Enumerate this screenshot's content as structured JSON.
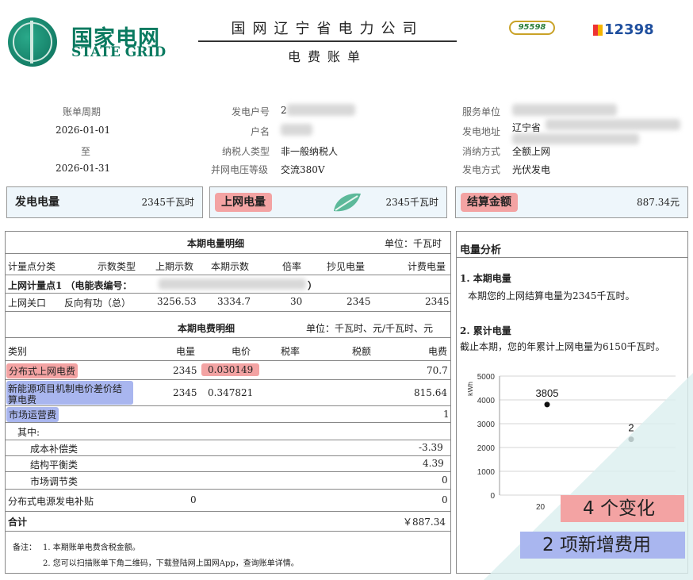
{
  "header": {
    "brand_cn": "国家电网",
    "brand_en": "STATE GRID",
    "company": "国网辽宁省电力公司",
    "bill_title": "电费账单",
    "hotline_95598": "95598",
    "hotline_12398": "12398"
  },
  "info": {
    "period_label": "账单周期",
    "period_start": "2026-01-01",
    "period_to": "至",
    "period_end": "2026-01-31",
    "account_label": "发电户号",
    "account_value": "2",
    "name_label": "户名",
    "taxpayer_label": "纳税人类型",
    "taxpayer_value": "非一般纳税人",
    "voltage_label": "并网电压等级",
    "voltage_value": "交流380V",
    "service_label": "服务单位",
    "address_label": "发电地址",
    "address_value": "辽宁省",
    "consumption_label": "消纳方式",
    "consumption_value": "全额上网",
    "gen_type_label": "发电方式",
    "gen_type_value": "光伏发电"
  },
  "summary": {
    "generation_label": "发电电量",
    "generation_value": "2345千瓦时",
    "grid_label": "上网电量",
    "grid_value": "2345千瓦时",
    "settle_label": "结算金额",
    "settle_value": "887.34元"
  },
  "energy_detail": {
    "title": "本期电量明细",
    "unit": "单位：千瓦时",
    "headers": [
      "计量点分类",
      "示数类型",
      "上期示数",
      "本期示数",
      "倍率",
      "抄见电量",
      "计费电量"
    ],
    "point_label": "上网计量点1 （电能表编号：",
    "point_close": "）",
    "row": [
      "上网关口",
      "反向有功（总）",
      "3256.53",
      "3334.7",
      "30",
      "2345",
      "2345"
    ]
  },
  "fee_detail": {
    "title": "本期电费明细",
    "unit": "单位：千瓦时、元/千瓦时、元",
    "headers": [
      "类别",
      "电量",
      "电价",
      "税率",
      "税额",
      "电费"
    ],
    "rows": [
      {
        "name": "分布式上网电费",
        "qty": "2345",
        "price": "0.030149",
        "fee": "70.7"
      },
      {
        "name": "新能源项目机制电价差价结算电费",
        "name_l1": "新能源项目机制电价差价结",
        "name_l2": "算电费",
        "qty": "2345",
        "price": "0.347821",
        "fee": "815.64"
      },
      {
        "name": "市场运营费",
        "fee": "1"
      },
      {
        "name": "其中:"
      },
      {
        "name": "成本补偿类",
        "fee": "-3.39"
      },
      {
        "name": "结构平衡类",
        "fee": "4.39"
      },
      {
        "name": "市场调节类",
        "fee": "0"
      },
      {
        "name": "分布式电源发电补贴",
        "qty": "0",
        "fee": "0"
      }
    ],
    "total_label": "合计",
    "total_value": "￥887.34"
  },
  "notes": {
    "label": "备注：",
    "line1": "1. 本期账单电费含税金额。",
    "line2": "2. 您可以扫描账单下角二维码，下载登陆网上国网App，查询账单详情。"
  },
  "analysis": {
    "title": "电量分析",
    "s1_title": "1. 本期电量",
    "s1_text": "本期您的上网结算电量为2345千瓦时。",
    "s2_title": "2. 累计电量",
    "s2_text": "截止本期，您的年累计上网电量为6150千瓦时。"
  },
  "chart_data": {
    "type": "line",
    "ylabel": "kWh",
    "ylim": [
      0,
      5000
    ],
    "yticks": [
      0,
      1000,
      2000,
      3000,
      4000,
      5000
    ],
    "x_tick_partial": "20",
    "points": [
      {
        "value": 3805,
        "label": "3805"
      },
      {
        "value": 2345,
        "label": "2"
      }
    ],
    "grid": true
  },
  "overlay": {
    "changes": "4 个变化",
    "new_fees": "2 项新增费用",
    "red_color": "#f3a3a3",
    "blue_color": "#a9b6ef"
  }
}
